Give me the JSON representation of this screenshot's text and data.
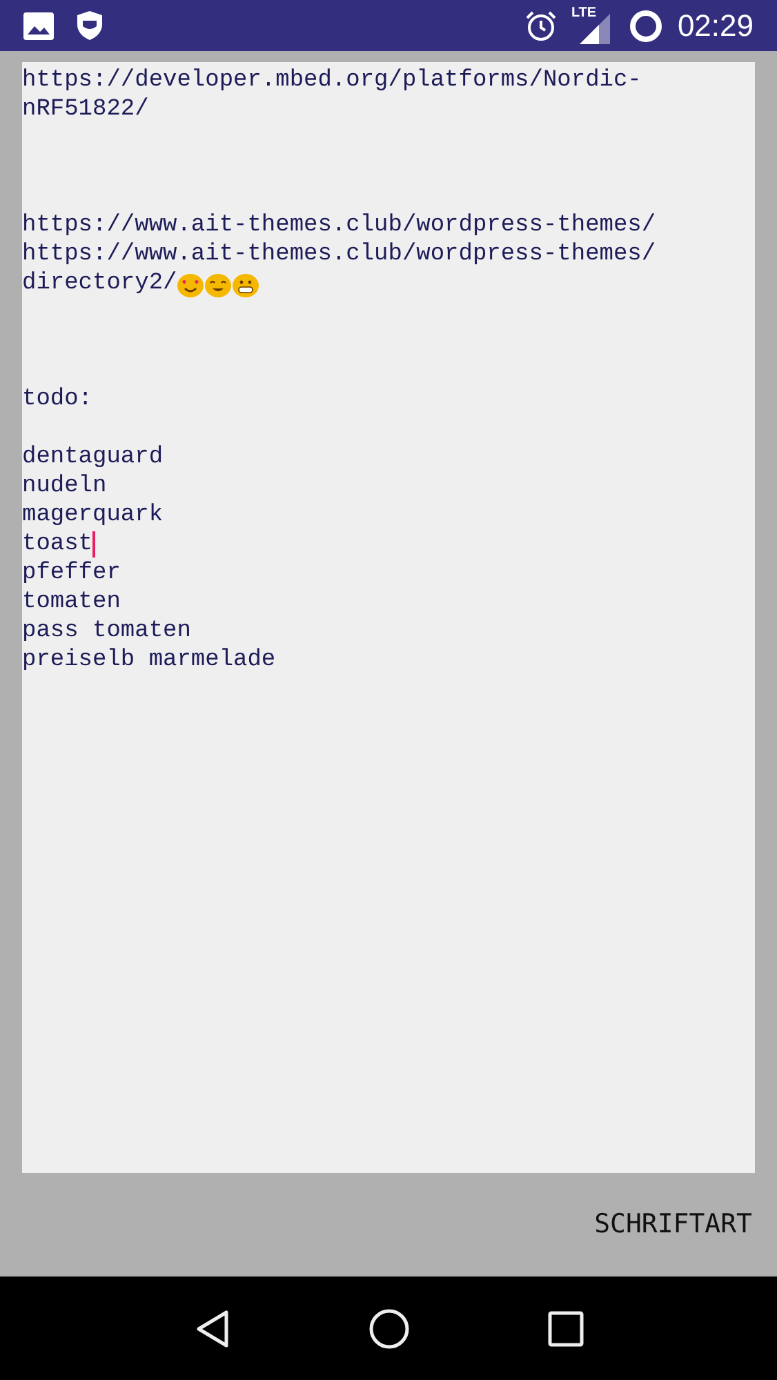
{
  "status_bar": {
    "network_label": "LTE",
    "time": "02:29"
  },
  "editor": {
    "lines": [
      {
        "kind": "text",
        "text": "https://developer.mbed.org/platforms/Nordic-",
        "cursor": false
      },
      {
        "kind": "text",
        "text": "nRF51822/",
        "cursor": false
      },
      {
        "kind": "blank"
      },
      {
        "kind": "blank"
      },
      {
        "kind": "blank"
      },
      {
        "kind": "text",
        "text": "https://www.ait-themes.club/wordpress-themes/",
        "cursor": false
      },
      {
        "kind": "text",
        "text": "https://www.ait-themes.club/wordpress-themes/",
        "cursor": false
      },
      {
        "kind": "emoji_text",
        "text": "directory2/",
        "cursor": false
      },
      {
        "kind": "blank"
      },
      {
        "kind": "blank"
      },
      {
        "kind": "blank"
      },
      {
        "kind": "text",
        "text": "todo:",
        "cursor": false
      },
      {
        "kind": "blank"
      },
      {
        "kind": "text",
        "text": "dentaguard",
        "cursor": false
      },
      {
        "kind": "text",
        "text": "nudeln",
        "cursor": false
      },
      {
        "kind": "text",
        "text": "magerquark",
        "cursor": false
      },
      {
        "kind": "text",
        "text": "toast",
        "cursor": true
      },
      {
        "kind": "text",
        "text": "pfeffer",
        "cursor": false
      },
      {
        "kind": "text",
        "text": "tomaten",
        "cursor": false
      },
      {
        "kind": "text",
        "text": "pass tomaten",
        "cursor": false
      },
      {
        "kind": "text",
        "text": "preiselb marmelade",
        "cursor": false
      }
    ]
  },
  "font_button": "SCHRIFTART"
}
